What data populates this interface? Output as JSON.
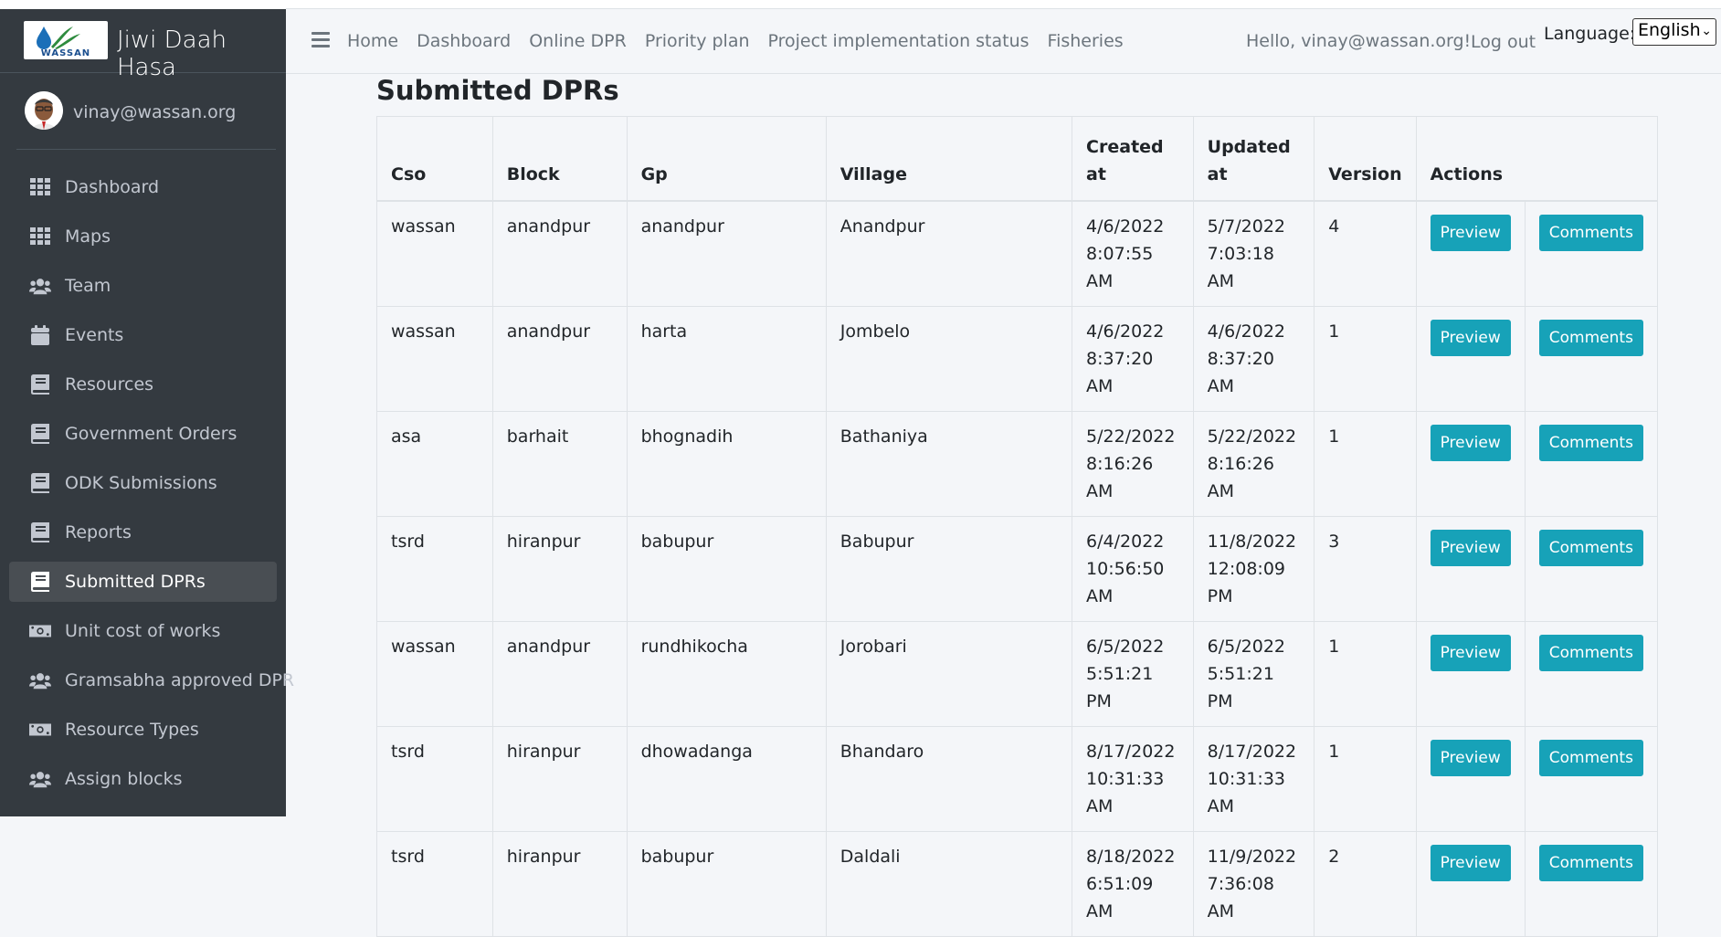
{
  "brand": {
    "title": "Jiwi Daah Hasa",
    "logo_text": "WASSAN"
  },
  "user": {
    "email": "vinay@wassan.org"
  },
  "sidebar": {
    "items": [
      {
        "label": "Dashboard",
        "icon": "grid-icon"
      },
      {
        "label": "Maps",
        "icon": "grid-icon"
      },
      {
        "label": "Team",
        "icon": "users-icon"
      },
      {
        "label": "Events",
        "icon": "calendar-icon"
      },
      {
        "label": "Resources",
        "icon": "book-icon"
      },
      {
        "label": "Government Orders",
        "icon": "book-icon"
      },
      {
        "label": "ODK Submissions",
        "icon": "book-icon"
      },
      {
        "label": "Reports",
        "icon": "book-icon"
      },
      {
        "label": "Submitted DPRs",
        "icon": "book-icon",
        "active": true
      },
      {
        "label": "Unit cost of works",
        "icon": "money-icon"
      },
      {
        "label": "Gramsabha approved DPR",
        "icon": "users-icon"
      },
      {
        "label": "Resource Types",
        "icon": "money-icon"
      },
      {
        "label": "Assign blocks",
        "icon": "users-icon"
      }
    ]
  },
  "navbar": {
    "links": [
      "Home",
      "Dashboard",
      "Online DPR",
      "Priority plan",
      "Project implementation status",
      "Fisheries"
    ],
    "greeting": "Hello, vinay@wassan.org!",
    "logout": "Log out",
    "language_label": "Language:",
    "language_value": "English"
  },
  "main": {
    "title": "Submitted DPRs",
    "table": {
      "headers": [
        "Cso",
        "Block",
        "Gp",
        "Village",
        "Created at",
        "Updated at",
        "Version",
        "Actions"
      ],
      "rows": [
        [
          "wassan",
          "anandpur",
          "anandpur",
          "Anandpur",
          "4/6/2022 8:07:55 AM",
          "5/7/2022 7:03:18 AM",
          "4"
        ],
        [
          "wassan",
          "anandpur",
          "harta",
          "Jombelo",
          "4/6/2022 8:37:20 AM",
          "4/6/2022 8:37:20 AM",
          "1"
        ],
        [
          "asa",
          "barhait",
          "bhognadih",
          "Bathaniya",
          "5/22/2022 8:16:26 AM",
          "5/22/2022 8:16:26 AM",
          "1"
        ],
        [
          "tsrd",
          "hiranpur",
          "babupur",
          "Babupur",
          "6/4/2022 10:56:50 AM",
          "11/8/2022 12:08:09 PM",
          "3"
        ],
        [
          "wassan",
          "anandpur",
          "rundhikocha",
          "Jorobari",
          "6/5/2022 5:51:21 PM",
          "6/5/2022 5:51:21 PM",
          "1"
        ],
        [
          "tsrd",
          "hiranpur",
          "dhowadanga",
          "Bhandaro",
          "8/17/2022 10:31:33 AM",
          "8/17/2022 10:31:33 AM",
          "1"
        ],
        [
          "tsrd",
          "hiranpur",
          "babupur",
          "Daldali",
          "8/18/2022 6:51:09 AM",
          "11/9/2022 7:36:08 AM",
          "2"
        ]
      ],
      "preview_label": "Preview",
      "comments_label": "Comments"
    }
  },
  "colors": {
    "sidebar_bg": "#343a40",
    "button_bg": "#17a2b8",
    "content_bg": "#f4f6f9"
  }
}
